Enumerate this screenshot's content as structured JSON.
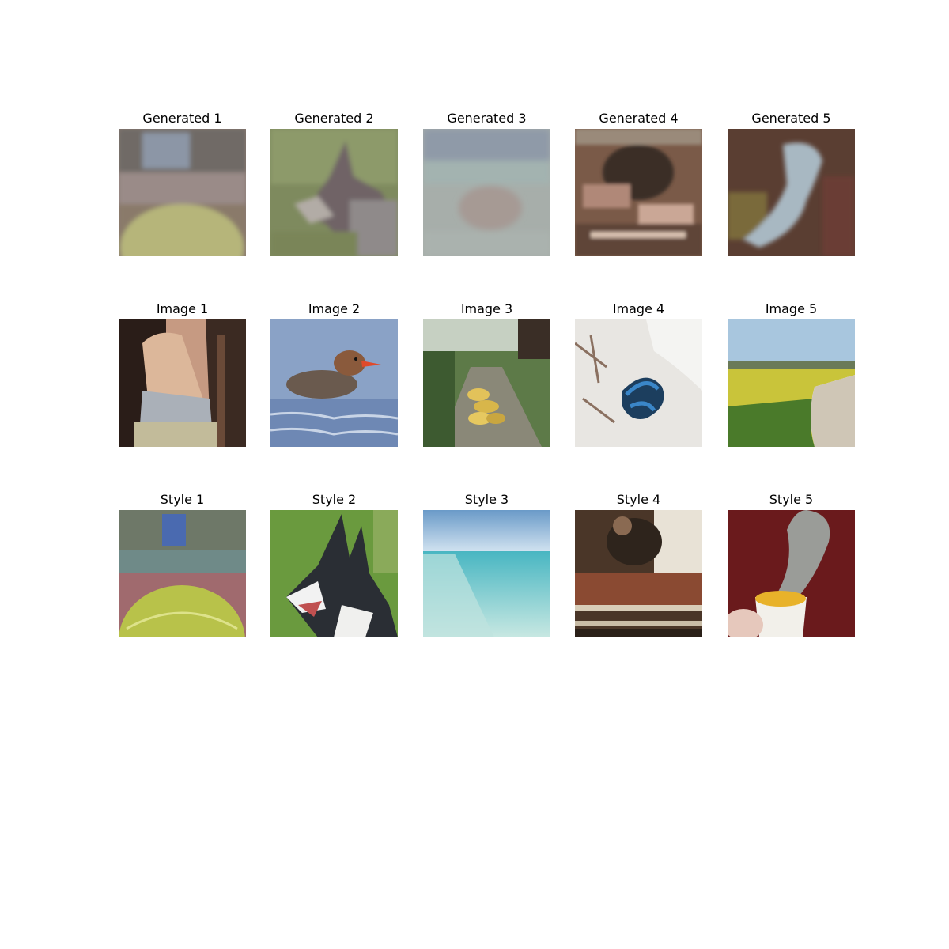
{
  "rows": [
    {
      "row_name": "generated-row",
      "cells": [
        {
          "title": "Generated 1",
          "subject": "generated-tennis-ball-image"
        },
        {
          "title": "Generated 2",
          "subject": "generated-dog-image"
        },
        {
          "title": "Generated 3",
          "subject": "generated-beach-image"
        },
        {
          "title": "Generated 4",
          "subject": "generated-workshop-image"
        },
        {
          "title": "Generated 5",
          "subject": "generated-cup-image"
        }
      ]
    },
    {
      "row_name": "content-row",
      "cells": [
        {
          "title": "Image 1",
          "subject": "bag-photo"
        },
        {
          "title": "Image 2",
          "subject": "duck-photo"
        },
        {
          "title": "Image 3",
          "subject": "bananas-photo"
        },
        {
          "title": "Image 4",
          "subject": "snake-photo"
        },
        {
          "title": "Image 5",
          "subject": "field-photo"
        }
      ]
    },
    {
      "row_name": "style-row",
      "cells": [
        {
          "title": "Style 1",
          "subject": "tennis-ball-photo"
        },
        {
          "title": "Style 2",
          "subject": "dog-photo"
        },
        {
          "title": "Style 3",
          "subject": "beach-photo"
        },
        {
          "title": "Style 4",
          "subject": "workshop-photo"
        },
        {
          "title": "Style 5",
          "subject": "cup-photo"
        }
      ]
    }
  ]
}
